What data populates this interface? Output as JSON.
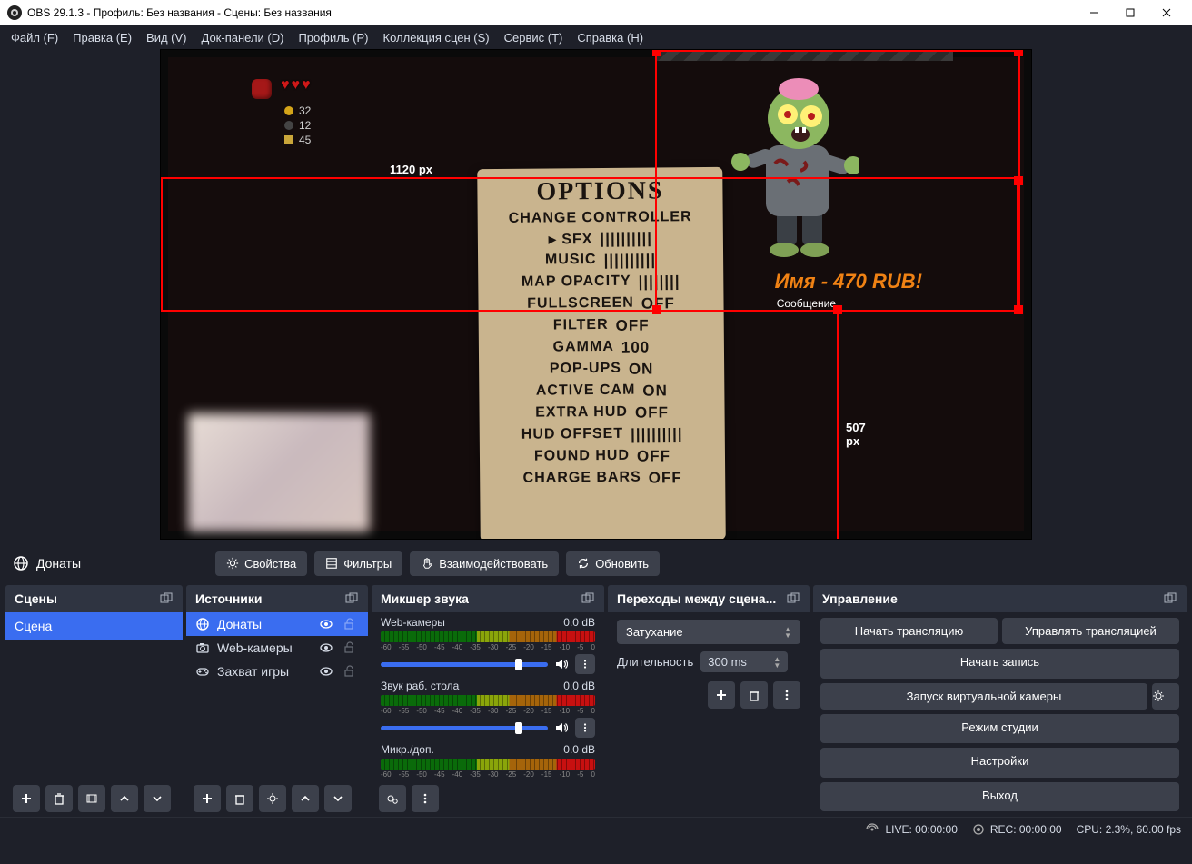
{
  "titlebar": {
    "title": "OBS 29.1.3 - Профиль: Без названия - Сцены: Без названия"
  },
  "menu": {
    "file": "Файл (F)",
    "edit": "Правка (E)",
    "view": "Вид (V)",
    "docks": "Док-панели (D)",
    "profile": "Профиль (P)",
    "scene_collection": "Коллекция сцен (S)",
    "service": "Сервис (T)",
    "help": "Справка (H)"
  },
  "preview": {
    "dim_width": "1120 px",
    "dim_height": "507 px",
    "hud": {
      "coins": "32",
      "bombs": "12",
      "keys": "45"
    },
    "options_title": "OPTIONS",
    "options": [
      {
        "k": "CHANGE CONTROLLER",
        "v": ""
      },
      {
        "k": "▸ SFX",
        "v": "||||||||||"
      },
      {
        "k": "MUSIC",
        "v": "||||||||||"
      },
      {
        "k": "MAP OPACITY",
        "v": "||||||||"
      },
      {
        "k": "FULLSCREEN",
        "v": "OFF"
      },
      {
        "k": "FILTER",
        "v": "OFF"
      },
      {
        "k": "GAMMA",
        "v": "100"
      },
      {
        "k": "POP-UPS",
        "v": "ON"
      },
      {
        "k": "ACTIVE CAM",
        "v": "ON"
      },
      {
        "k": "EXTRA HUD",
        "v": "OFF"
      },
      {
        "k": "HUD OFFSET",
        "v": "||||||||||"
      },
      {
        "k": "FOUND HUD",
        "v": "OFF"
      },
      {
        "k": "CHARGE BARS",
        "v": "OFF"
      }
    ],
    "donation": "Имя - 470 RUB!",
    "message_label": "Сообщение"
  },
  "context": {
    "subject": "Донаты",
    "properties": "Свойства",
    "filters": "Фильтры",
    "interact": "Взаимодействовать",
    "refresh": "Обновить"
  },
  "scenes": {
    "title": "Сцены",
    "items": [
      "Сцена"
    ]
  },
  "sources": {
    "title": "Источники",
    "items": [
      {
        "icon": "globe",
        "name": "Донаты",
        "selected": true
      },
      {
        "icon": "camera",
        "name": "Web-камеры",
        "selected": false
      },
      {
        "icon": "gamepad",
        "name": "Захват игры",
        "selected": false
      }
    ]
  },
  "mixer": {
    "title": "Микшер звука",
    "channels": [
      {
        "name": "Web-камеры",
        "level": "0.0 dB"
      },
      {
        "name": "Звук раб. стола",
        "level": "0.0 dB"
      },
      {
        "name": "Микр./доп.",
        "level": "0.0 dB"
      }
    ],
    "ticks": [
      "-60",
      "-55",
      "-50",
      "-45",
      "-40",
      "-35",
      "-30",
      "-25",
      "-20",
      "-15",
      "-10",
      "-5",
      "0"
    ]
  },
  "transitions": {
    "title": "Переходы между сцена...",
    "selected": "Затухание",
    "duration_label": "Длительность",
    "duration_value": "300 ms"
  },
  "controls": {
    "title": "Управление",
    "start_stream": "Начать трансляцию",
    "manage_stream": "Управлять трансляцией",
    "start_record": "Начать запись",
    "start_vcam": "Запуск виртуальной камеры",
    "studio_mode": "Режим студии",
    "settings": "Настройки",
    "exit": "Выход"
  },
  "status": {
    "live": "LIVE: 00:00:00",
    "rec": "REC: 00:00:00",
    "cpu": "CPU: 2.3%, 60.00 fps"
  }
}
